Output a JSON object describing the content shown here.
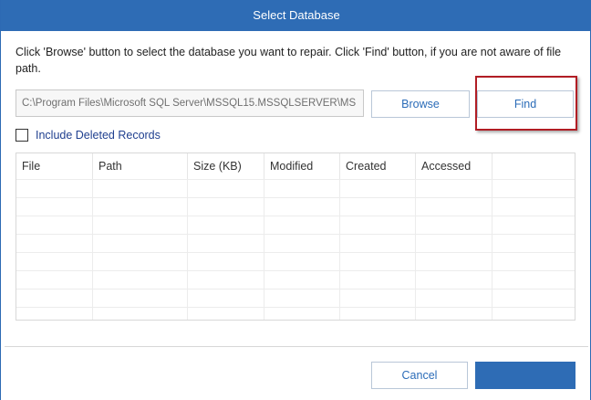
{
  "dialog": {
    "title": "Select Database",
    "instruction": "Click 'Browse' button to select the database you want to repair. Click 'Find' button, if you are not aware of file path."
  },
  "path_field": {
    "value": "C:\\Program Files\\Microsoft SQL Server\\MSSQL15.MSSQLSERVER\\MS"
  },
  "buttons": {
    "browse": "Browse",
    "find": "Find",
    "cancel": "Cancel"
  },
  "checkbox": {
    "label": "Include Deleted Records",
    "checked": false
  },
  "table": {
    "columns": [
      "File",
      "Path",
      "Size (KB)",
      "Modified",
      "Created",
      "Accessed"
    ],
    "rows": []
  },
  "colors": {
    "titlebar": "#2e6cb5",
    "accent": "#2b6cb8",
    "highlight_border": "#b11d24"
  }
}
